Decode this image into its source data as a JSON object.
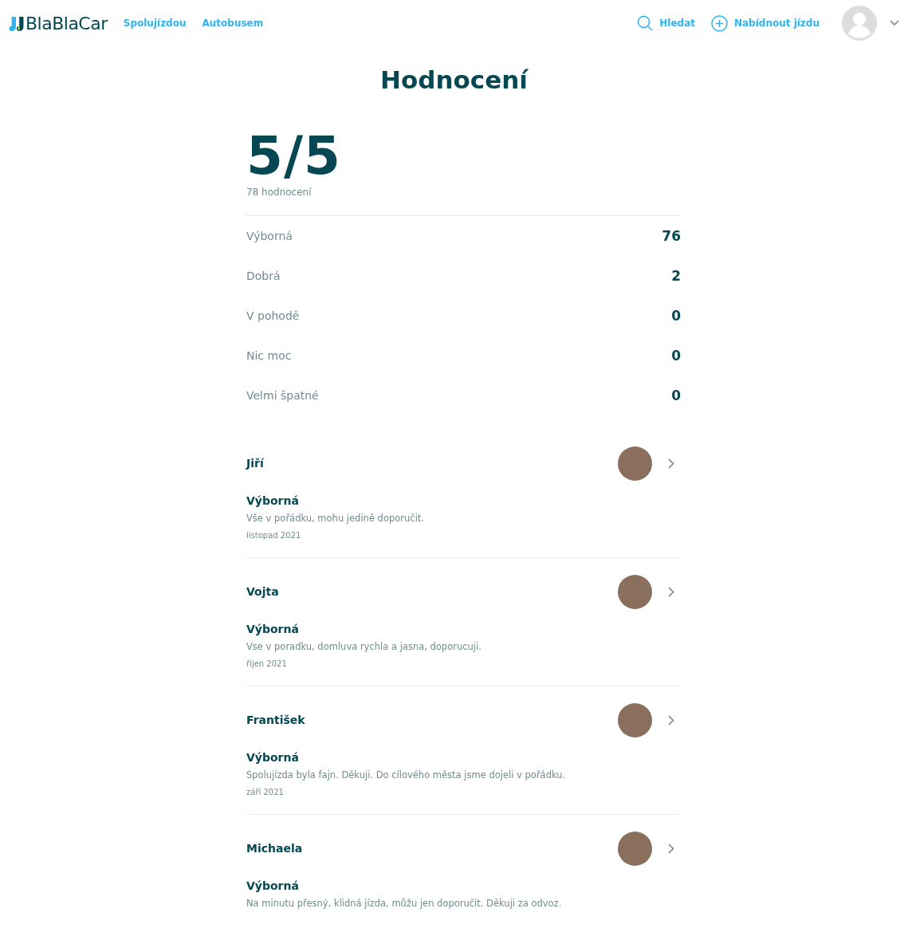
{
  "header": {
    "logo": "BlaBlaCar",
    "nav": [
      "Spolujízdou",
      "Autobusem"
    ],
    "actions": [
      {
        "kind": "search",
        "label": "Hledat"
      },
      {
        "kind": "add",
        "label": "Nabídnout jízdu"
      }
    ]
  },
  "title": "Hodnocení",
  "summary": {
    "score": "5/5",
    "count": "78 hodnocení"
  },
  "breakdown": [
    {
      "label": "Výborná",
      "count": "76"
    },
    {
      "label": "Dobrá",
      "count": "2"
    },
    {
      "label": "V pohodě",
      "count": "0"
    },
    {
      "label": "Nic moc",
      "count": "0"
    },
    {
      "label": "Velmi špatné",
      "count": "0"
    }
  ],
  "reviews": [
    {
      "name": "Jiří",
      "rating": "Výborná",
      "comment": "Vše v pořádku, mohu jedině doporučit.",
      "date": "listopad 2021"
    },
    {
      "name": "Vojta",
      "rating": "Výborná",
      "comment": "Vse v poradku, domluva rychla a jasna, doporucuji.",
      "date": "říjen 2021"
    },
    {
      "name": "František",
      "rating": "Výborná",
      "comment": "Spolujízda byla fajn. Děkuji. Do cílového města jsme dojeli v pořádku.",
      "date": "září 2021"
    },
    {
      "name": "Michaela",
      "rating": "Výborná",
      "comment": "Na minutu přesný, klidná jízda, můžu jen doporučit. Děkuji za odvoz."
    }
  ]
}
